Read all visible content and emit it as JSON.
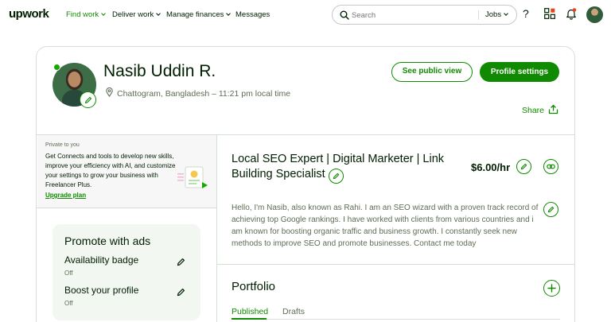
{
  "nav": {
    "logo": "upwork",
    "items": [
      {
        "label": "Find work",
        "active": true,
        "dropdown": true
      },
      {
        "label": "Deliver work",
        "active": false,
        "dropdown": true
      },
      {
        "label": "Manage finances",
        "active": false,
        "dropdown": true
      },
      {
        "label": "Messages",
        "active": false,
        "dropdown": false
      }
    ],
    "search_placeholder": "Search",
    "search_scope": "Jobs",
    "help_glyph": "?",
    "icons": [
      "help-icon",
      "apps-icon",
      "notifications-icon",
      "avatar"
    ]
  },
  "profile": {
    "name": "Nasib Uddin R.",
    "location": "Chattogram, Bangladesh – 11:21 pm local time",
    "see_public_view": "See public view",
    "profile_settings": "Profile settings",
    "share": "Share"
  },
  "promo": {
    "private_label": "Private to you",
    "text": "Get Connects and tools to develop new skills, improve your efficiency with AI, and customize your settings to grow your business with Freelancer Plus.",
    "upgrade": "Upgrade plan"
  },
  "ads": {
    "title": "Promote with ads",
    "items": [
      {
        "label": "Availability badge",
        "status": "Off"
      },
      {
        "label": "Boost your profile",
        "status": "Off"
      }
    ]
  },
  "main": {
    "headline": "Local SEO Expert | Digital Marketer | Link Building Specialist",
    "rate": "$6.00/hr",
    "bio": "Hello, I'm Nasib, also known as Rahi. I am an SEO wizard with a proven track record of achieving top Google rankings. I have worked with clients from various countries and i am known for boosting organic traffic and business growth. I constantly seek new methods to improve SEO and promote businesses. Contact me today",
    "portfolio_title": "Portfolio",
    "tabs": [
      {
        "label": "Published",
        "active": true
      },
      {
        "label": "Drafts",
        "active": false
      }
    ]
  },
  "colors": {
    "brand_green": "#108a00",
    "online_green": "#14a800",
    "notification_red": "#e4431d",
    "text_dark": "#001e00",
    "text_muted": "#5e6d55",
    "border": "#d5e0d5"
  }
}
